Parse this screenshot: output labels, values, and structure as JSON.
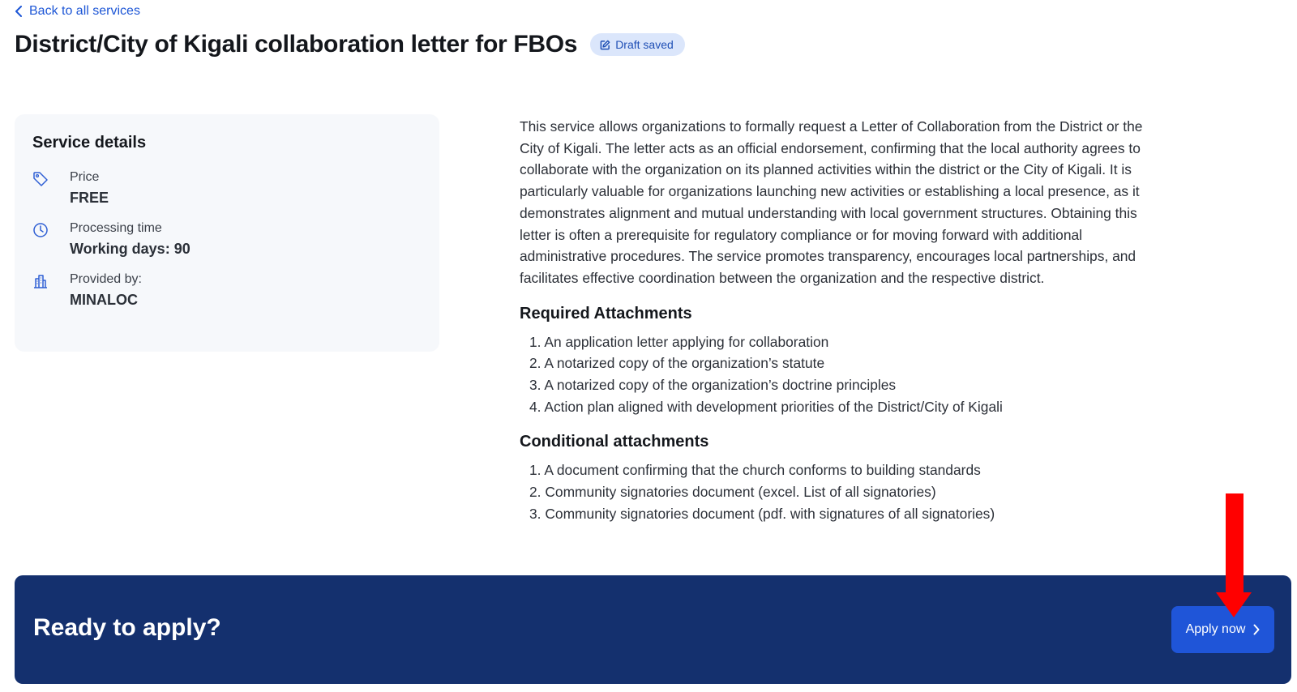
{
  "nav": {
    "back_label": "Back to all services"
  },
  "header": {
    "title": "District/City of Kigali collaboration letter for FBOs",
    "status_badge": "Draft saved"
  },
  "service_details": {
    "heading": "Service details",
    "items": [
      {
        "icon": "tag-icon",
        "label": "Price",
        "value": "FREE"
      },
      {
        "icon": "clock-icon",
        "label": "Processing time",
        "value": "Working days: 90"
      },
      {
        "icon": "building-icon",
        "label": "Provided by:",
        "value": "MINALOC"
      }
    ]
  },
  "description": "This service allows organizations to formally request a Letter of Collaboration from the District or the City of Kigali. The letter acts as an official endorsement, confirming that the local authority agrees to collaborate with the organization on its planned activities within the district or the City of Kigali. It is particularly valuable for organizations launching new activities or establishing a local presence, as it demonstrates alignment and mutual understanding with local government structures. Obtaining this letter is often a prerequisite for regulatory compliance or for moving forward with additional administrative procedures. The service promotes transparency, encourages local partnerships, and facilitates effective coordination between the organization and the respective district.",
  "required_attachments": {
    "heading": "Required Attachments",
    "items": [
      "1. An application letter applying for collaboration",
      "2. A notarized copy of the organization’s statute",
      "3. A notarized copy of the organization’s doctrine principles",
      "4. Action plan aligned with development priorities of the District/City of Kigali"
    ]
  },
  "conditional_attachments": {
    "heading": "Conditional attachments",
    "items": [
      "1. A document confirming that the church conforms to building standards",
      "2. Community signatories document (excel. List of all signatories)",
      "3. Community signatories document (pdf. with signatures of all signatories)"
    ]
  },
  "cta": {
    "title": "Ready to apply?",
    "button_label": "Apply now"
  },
  "colors": {
    "link": "#1d56d6",
    "banner": "#14306e",
    "button": "#1f55d8",
    "annotation_arrow": "#ff0000"
  }
}
